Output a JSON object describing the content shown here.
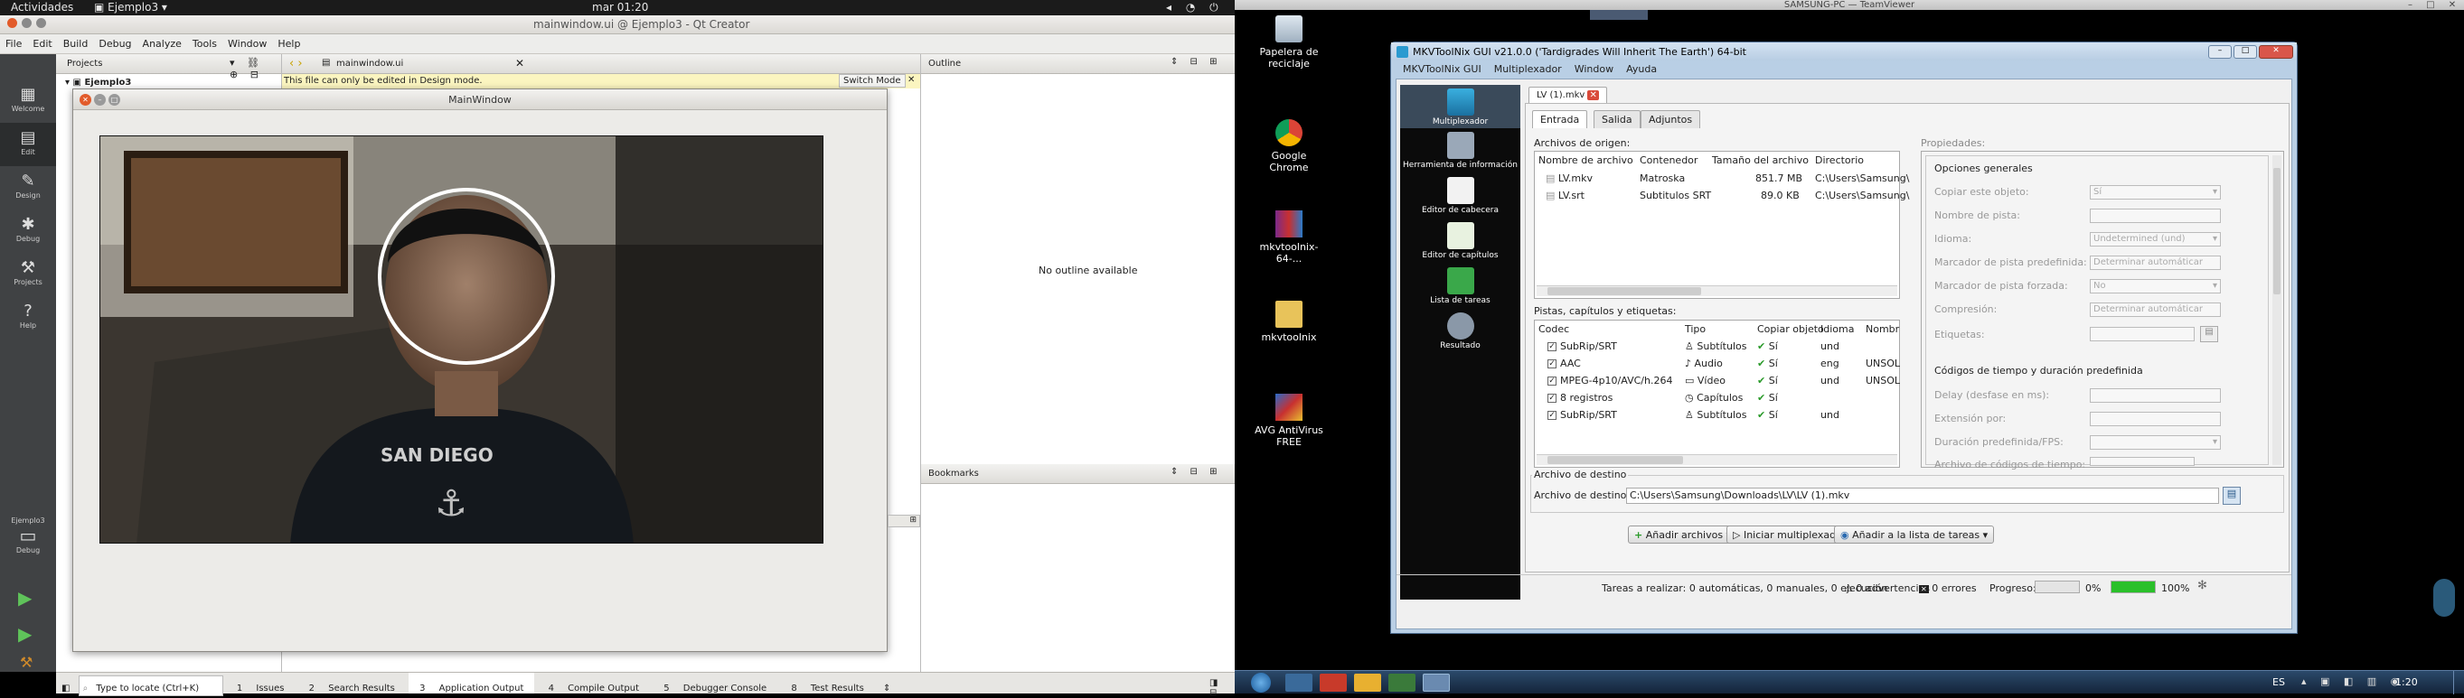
{
  "gnome": {
    "activities": "Actividades",
    "app": "Ejemplo3",
    "clock": "mar 01:20"
  },
  "qtc": {
    "window_title": "mainwindow.ui @ Ejemplo3 - Qt Creator",
    "menus": [
      "File",
      "Edit",
      "Build",
      "Debug",
      "Analyze",
      "Tools",
      "Window",
      "Help"
    ],
    "modes": [
      "Welcome",
      "Edit",
      "Design",
      "Debug",
      "Projects",
      "Help"
    ],
    "kit": {
      "project": "Ejemplo3",
      "config": "Debug"
    },
    "projects_label": "Projects",
    "tree_root": "Ejemplo3",
    "file_combo": "mainwindow.ui",
    "readonly_notice": "This file can only be edited in Design mode.",
    "switch_mode": "Switch Mode",
    "outline_label": "Outline",
    "no_outline": "No outline available",
    "bookmarks_label": "Bookmarks",
    "mainwindow_title": "MainWindow",
    "locator_placeholder": "Type to locate (Ctrl+K)",
    "output_tabs": [
      {
        "n": "1",
        "label": "Issues"
      },
      {
        "n": "2",
        "label": "Search Results"
      },
      {
        "n": "3",
        "label": "Application Output"
      },
      {
        "n": "4",
        "label": "Compile Output"
      },
      {
        "n": "5",
        "label": "Debugger Console"
      },
      {
        "n": "8",
        "label": "Test Results"
      }
    ]
  },
  "tv": {
    "title": "SAMSUNG-PC — TeamViewer"
  },
  "desktop": {
    "icons": [
      "Papelera de reciclaje",
      "Google Chrome",
      "mkvtoolnix-64-...",
      "mkvtoolnix",
      "AVG AntiVirus FREE"
    ],
    "tray": {
      "lang": "ES",
      "time": "1:20"
    }
  },
  "mkv": {
    "title": "MKVToolNix GUI v21.0.0 ('Tardigrades Will Inherit The Earth') 64-bit",
    "menus": [
      "MKVToolNix GUI",
      "Multiplexador",
      "Window",
      "Ayuda"
    ],
    "sidebar": [
      "Multiplexador",
      "Herramienta de información",
      "Editor de cabecera",
      "Editor de capítulos",
      "Lista de tareas",
      "Resultado"
    ],
    "doc_tab": "LV (1).mkv",
    "tabs": [
      "Entrada",
      "Salida",
      "Adjuntos"
    ],
    "sources_label": "Archivos de origen:",
    "source_headers": [
      "Nombre de archivo",
      "Contenedor",
      "Tamaño del archivo",
      "Directorio"
    ],
    "sources": [
      {
        "name": "LV.mkv",
        "container": "Matroska",
        "size": "851.7 MB",
        "dir": "C:\\Users\\Samsung\\"
      },
      {
        "name": "LV.srt",
        "container": "Subtitulos SRT",
        "size": "89.0 KB",
        "dir": "C:\\Users\\Samsung\\"
      }
    ],
    "tracks_label": "Pistas, capítulos y etiquetas:",
    "track_headers": [
      "Codec",
      "Tipo",
      "Copiar objeto",
      "Idioma",
      "Nombr"
    ],
    "tracks": [
      {
        "codec": "SubRip/SRT",
        "type": "Subtítulos",
        "copy": "Sí",
        "lang": "und"
      },
      {
        "codec": "AAC",
        "type": "Audio",
        "copy": "Sí",
        "lang": "eng",
        "name": "UNSOL"
      },
      {
        "codec": "MPEG-4p10/AVC/h.264",
        "type": "Vídeo",
        "copy": "Sí",
        "lang": "und",
        "name": "UNSOL"
      },
      {
        "codec": "8 registros",
        "type": "Capítulos",
        "copy": "Sí",
        "lang": ""
      },
      {
        "codec": "SubRip/SRT",
        "type": "Subtítulos",
        "copy": "Sí",
        "lang": "und"
      }
    ],
    "props_label": "Propiedades:",
    "general_label": "Opciones generales",
    "general": [
      {
        "label": "Copiar este objeto:",
        "value": "Sí"
      },
      {
        "label": "Nombre de pista:",
        "value": ""
      },
      {
        "label": "Idioma:",
        "value": "Undetermined (und)"
      },
      {
        "label": "Marcador de pista predefinida:",
        "value": "Determinar automáticar"
      },
      {
        "label": "Marcador de pista forzada:",
        "value": "No"
      },
      {
        "label": "Compresión:",
        "value": "Determinar automáticar"
      },
      {
        "label": "Etiquetas:",
        "value": ""
      }
    ],
    "timing_label": "Códigos de tiempo y duración predefinida",
    "timing": [
      {
        "label": "Delay (desfase en ms):",
        "value": ""
      },
      {
        "label": "Extensión por:",
        "value": ""
      },
      {
        "label": "Duración predefinida/FPS:",
        "value": ""
      },
      {
        "label": "Archivo de códigos de tiempo:",
        "value": ""
      }
    ],
    "dest_group": "Archivo de destino",
    "dest_label": "Archivo de destino:",
    "dest_value": "C:\\Users\\Samsung\\Downloads\\LV\\LV (1).mkv",
    "btn_add": "Añadir archivos",
    "btn_start": "Iniciar multiplexado",
    "btn_queue": "Añadir a la lista de tareas",
    "status_tasks": "Tareas a realizar: 0 automáticas, 0 manuales, 0 ejecución",
    "status_warn": "0 advertencias",
    "status_err": "0 errores",
    "progress_label": "Progreso:",
    "progress_current": "0%",
    "progress_total": "100%",
    "progress_current_value": 0,
    "progress_total_value": 100
  }
}
